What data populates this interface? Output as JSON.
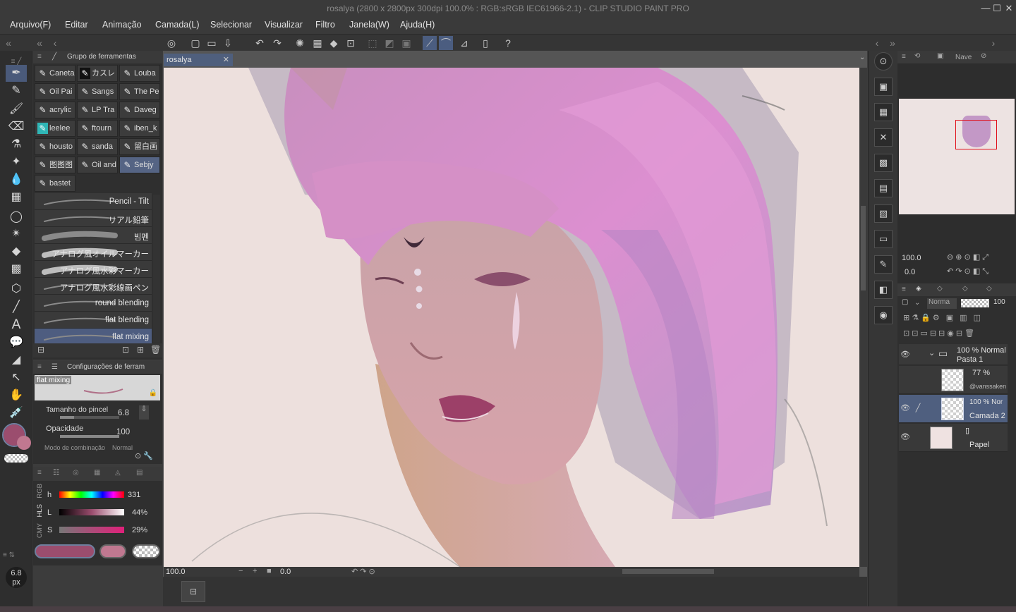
{
  "title_bar": {
    "title": "rosalya (2800 x 2800px 300dpi 100.0% : RGB:sRGB IEC61966-2.1)  - CLIP STUDIO PAINT PRO",
    "minimize": "—",
    "maximize": "☐",
    "close": "✕"
  },
  "menu": {
    "items": [
      "Arquivo(F)",
      "Editar",
      "Animação",
      "Camada(L)",
      "Selecionar",
      "Visualizar",
      "Filtro",
      "Janela(W)",
      "Ajuda(H)"
    ]
  },
  "subtool_panel": {
    "header": "Grupo de ferramentas",
    "brushes": [
      [
        "Caneta",
        "カスレ",
        "Louba"
      ],
      [
        "Oil Pai",
        "Sangs",
        "The Pe"
      ],
      [
        "acrylic",
        "LP Tra",
        "Daveg"
      ],
      [
        "leelee",
        "ftourn",
        "iben_k"
      ],
      [
        "housto",
        "sanda",
        "留白画"
      ],
      [
        "图图图",
        "Oil and",
        "Sebjy"
      ],
      [
        "bastet"
      ]
    ],
    "strokes": [
      "Pencil - Tilt",
      "リアル鉛筆",
      "빔펜",
      "アナログ風オイルマーカー",
      "アナログ風水彩マーカー",
      "アナログ風水彩線画ペン",
      "round blending",
      "flat blending",
      "flat mixing"
    ]
  },
  "tool_settings": {
    "header": "Configurações de ferram",
    "brush_name": "flat mixing",
    "size_label": "Tamanho do pincel",
    "size_value": "6.8",
    "opacity_label": "Opacidade",
    "opacity_value": "100",
    "blend_label": "Modo de combinação",
    "blend_value": "Normal"
  },
  "color_panel": {
    "tabs": [
      "RGB",
      "HLS",
      "CMY"
    ],
    "rows": [
      {
        "label": "h",
        "value": "331"
      },
      {
        "label": "L",
        "value": "44%"
      },
      {
        "label": "S",
        "value": "29%"
      }
    ],
    "main_color": "#9b4d6e",
    "sub_color": "#c07890"
  },
  "brush_size_indicator": {
    "value": "6.8",
    "unit": "px"
  },
  "document": {
    "tab_name": "rosalya",
    "zoom": "100.0",
    "angle": "0.0"
  },
  "navigator": {
    "tab": "Nave",
    "zoom": "100.0",
    "angle": "0.0"
  },
  "layers": {
    "blend_mode": "Norma",
    "opacity": "100",
    "items": [
      {
        "line1": "100 % Normal",
        "line2": "Pasta 1"
      },
      {
        "line1": "77 %",
        "line2": "@vanssaken"
      },
      {
        "line1": "100 % Nor",
        "line2": "Camada 2"
      },
      {
        "line1": "",
        "line2": "Papel"
      }
    ]
  },
  "colors": {
    "accent": "#4f5f7f",
    "canvas_bg": "#ede0dd",
    "hair": "#d48ec4"
  }
}
